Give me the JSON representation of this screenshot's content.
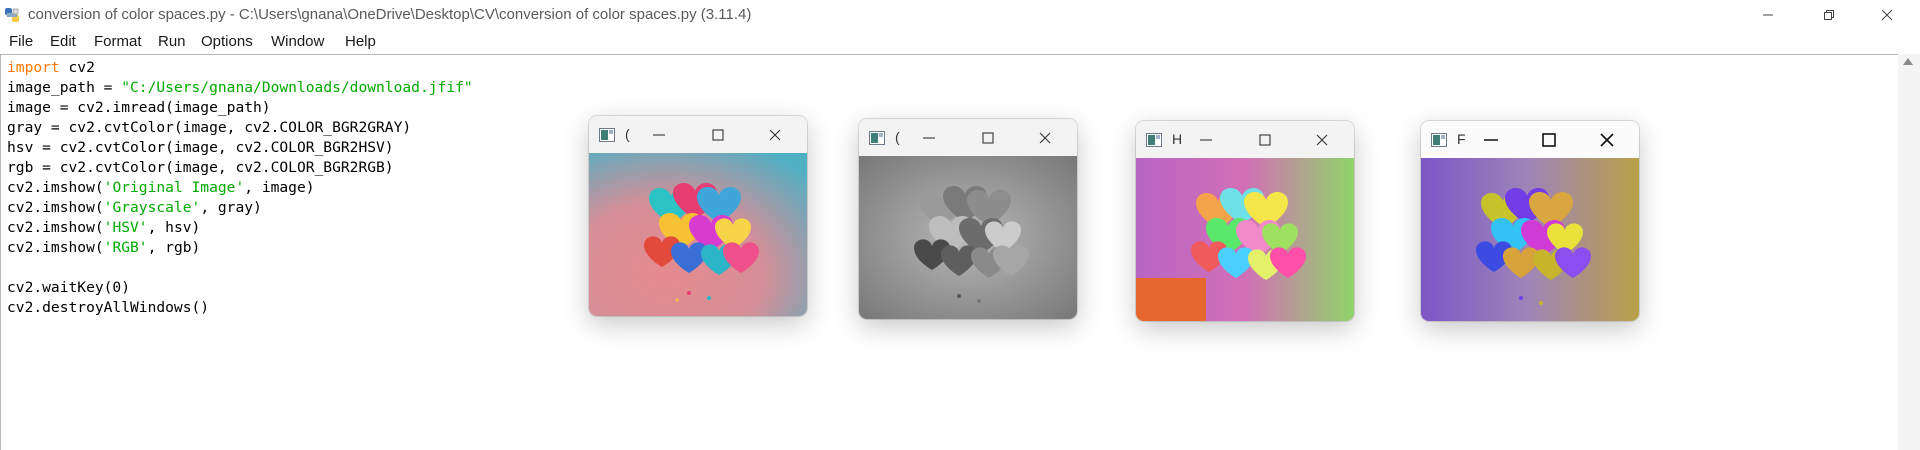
{
  "window": {
    "title": "conversion of color spaces.py - C:\\Users\\gnana\\OneDrive\\Desktop\\CV\\conversion of color spaces.py (3.11.4)",
    "app_icon": "python-idle-icon",
    "controls": [
      "minimize-icon",
      "restore-icon",
      "close-icon"
    ]
  },
  "menu": {
    "file": "File",
    "edit": "Edit",
    "format": "Format",
    "run": "Run",
    "options": "Options",
    "window": "Window",
    "help": "Help"
  },
  "code": {
    "l1_kw": "import",
    "l1_rest": " cv2",
    "l2_a": "image_path = ",
    "l2_str": "\"C:/Users/gnana/Downloads/download.jfif\"",
    "l3": "image = cv2.imread(image_path)",
    "l4": "gray = cv2.cvtColor(image, cv2.COLOR_BGR2GRAY)",
    "l5": "hsv = cv2.cvtColor(image, cv2.COLOR_BGR2HSV)",
    "l6": "rgb = cv2.cvtColor(image, cv2.COLOR_BGR2RGB)",
    "l7_a": "cv2.imshow(",
    "l7_str": "'Original Image'",
    "l7_b": ", image)",
    "l8_a": "cv2.imshow(",
    "l8_str": "'Grayscale'",
    "l8_b": ", gray)",
    "l9_a": "cv2.imshow(",
    "l9_str": "'HSV'",
    "l9_b": ", hsv)",
    "l10_a": "cv2.imshow(",
    "l10_str": "'RGB'",
    "l10_b": ", rgb)",
    "l12": "cv2.waitKey(0)",
    "l13": "cv2.destroyAllWindows()"
  },
  "colors": {
    "keyword": "#ff7700",
    "string": "#00aa00"
  },
  "image_windows": [
    {
      "title": "(",
      "image": "original-balloons-image"
    },
    {
      "title": "(",
      "image": "grayscale-balloons-image"
    },
    {
      "title": "H",
      "image": "hsv-balloons-image"
    },
    {
      "title": "F",
      "image": "rgb-balloons-image"
    }
  ]
}
